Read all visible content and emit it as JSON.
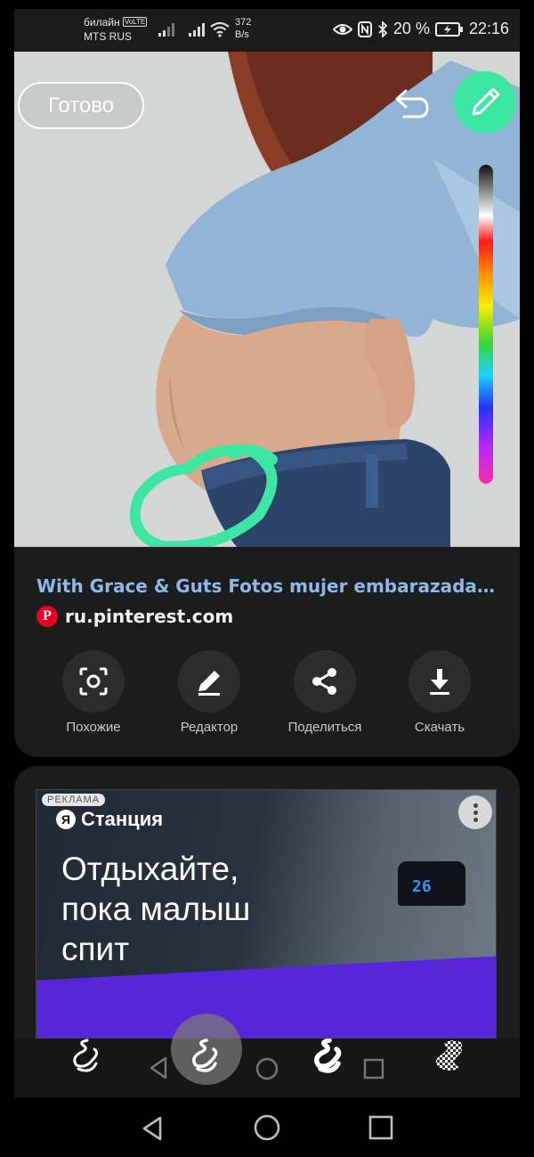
{
  "status_bar": {
    "carrier_line1": "билайн",
    "volte": "VoLTE",
    "carrier_line2": "MTS RUS",
    "net_speed_value": "372",
    "net_speed_unit": "B/s",
    "battery_percent": "20 %",
    "time": "22:16"
  },
  "editor": {
    "done_label": "Готово",
    "undo_icon": "undo-icon",
    "pen_icon": "pencil-icon",
    "active_color": "#3ee6a3",
    "color_slider": [
      "#111111",
      "#ffffff",
      "#ff1a1a",
      "#ff8c00",
      "#ffee00",
      "#37d637",
      "#19d4ff",
      "#2233ff",
      "#b327ff",
      "#ff2ba6"
    ]
  },
  "result": {
    "title": "With Grace & Guts Fotos mujer embarazada, F...",
    "source_logo": "P",
    "source": "ru.pinterest.com",
    "actions": [
      {
        "label": "Похожие",
        "icon": "scan-icon"
      },
      {
        "label": "Редактор",
        "icon": "pencil-icon"
      },
      {
        "label": "Поделиться",
        "icon": "share-icon"
      },
      {
        "label": "Скачать",
        "icon": "download-icon"
      }
    ]
  },
  "ad": {
    "badge": "РЕКЛАМА",
    "brand_logo": "Я",
    "brand": "Станция",
    "headline_line1": "Отдыхайте,",
    "headline_line2": "пока малыш",
    "headline_line3": "спит",
    "clock": "26"
  },
  "brush_toolbar": {
    "brushes": [
      "squiggle-brush-icon",
      "squiggle-brush-icon",
      "squiggle-bold-brush-icon",
      "eraser-checker-icon"
    ],
    "selected_index": 1
  }
}
